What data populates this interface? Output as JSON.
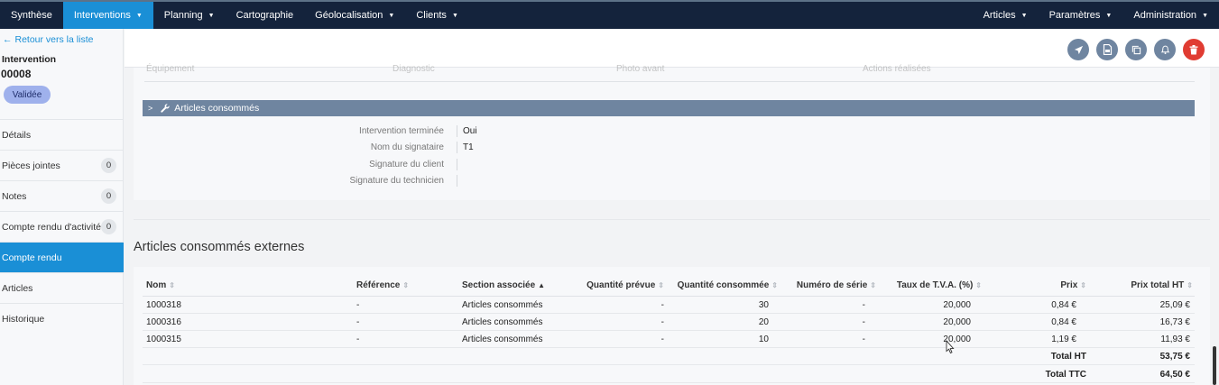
{
  "nav": {
    "items": [
      {
        "label": "Synthèse",
        "caret": false,
        "active": false
      },
      {
        "label": "Interventions",
        "caret": true,
        "active": true
      },
      {
        "label": "Planning",
        "caret": true,
        "active": false
      },
      {
        "label": "Cartographie",
        "caret": false,
        "active": false
      },
      {
        "label": "Géolocalisation",
        "caret": true,
        "active": false
      },
      {
        "label": "Clients",
        "caret": true,
        "active": false
      }
    ],
    "right_items": [
      {
        "label": "Articles",
        "caret": true
      },
      {
        "label": "Paramètres",
        "caret": true
      },
      {
        "label": "Administration",
        "caret": true
      }
    ]
  },
  "sidebar": {
    "back_label": "Retour vers la liste",
    "title": "Intervention",
    "number": "00008",
    "status": "Validée",
    "status_color": "#9fb1ec",
    "items": [
      {
        "label": "Détails",
        "count": null,
        "active": false
      },
      {
        "label": "Pièces jointes",
        "count": "0",
        "active": false
      },
      {
        "label": "Notes",
        "count": "0",
        "active": false
      },
      {
        "label": "Compte rendu d'activité",
        "count": "0",
        "active": false
      },
      {
        "label": "Compte rendu",
        "count": null,
        "active": true
      },
      {
        "label": "Articles",
        "count": null,
        "active": false
      },
      {
        "label": "Historique",
        "count": null,
        "active": false
      }
    ]
  },
  "header_actions": [
    {
      "icon": "send-icon"
    },
    {
      "icon": "pdf-icon"
    },
    {
      "icon": "copy-icon"
    },
    {
      "icon": "bell-icon"
    },
    {
      "icon": "trash-icon"
    }
  ],
  "report": {
    "partial_headers": [
      "Équipement",
      "Diagnostic",
      "Photo avant",
      "Actions réalisées"
    ],
    "section_title": "Articles consommés",
    "fields": [
      {
        "label": "Intervention terminée",
        "value": "Oui"
      },
      {
        "label": "Nom du signataire",
        "value": "T1"
      },
      {
        "label": "Signature du client",
        "value": ""
      },
      {
        "label": "Signature du technicien",
        "value": ""
      }
    ]
  },
  "external": {
    "title": "Articles consommés externes",
    "columns": [
      "Nom",
      "Référence",
      "Section associée",
      "Quantité prévue",
      "Quantité consommée",
      "Numéro de série",
      "Taux de T.V.A. (%)",
      "Prix",
      "Prix total HT"
    ],
    "rows": [
      [
        "1000318",
        "-",
        "Articles consommés",
        "-",
        "30",
        "-",
        "20,000",
        "0,84 €",
        "25,09 €"
      ],
      [
        "1000316",
        "-",
        "Articles consommés",
        "-",
        "20",
        "-",
        "20,000",
        "0,84 €",
        "16,73 €"
      ],
      [
        "1000315",
        "-",
        "Articles consommés",
        "-",
        "10",
        "-",
        "20,000",
        "1,19 €",
        "11,93 €"
      ]
    ],
    "total_ht_label": "Total HT",
    "total_ht": "53,75 €",
    "total_ttc_label": "Total TTC",
    "total_ttc": "64,50 €"
  },
  "colors": {
    "nav_bg": "#14233c",
    "accent": "#1a8fd6",
    "section_bar": "#6f85a0",
    "danger": "#e03c32"
  }
}
